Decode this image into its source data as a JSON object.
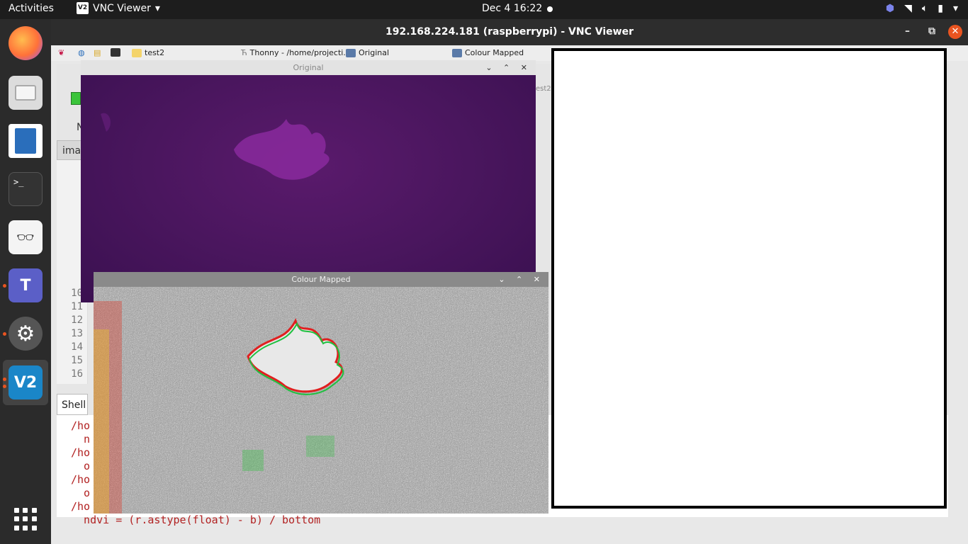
{
  "topbar": {
    "activities": "Activities",
    "app_name": "VNC Viewer",
    "clock": "Dec 4  16:22",
    "tray_icons": [
      "teams-tray-icon",
      "wifi-icon",
      "volume-icon",
      "battery-icon",
      "chevron-down-icon"
    ]
  },
  "dock": {
    "apps": [
      "firefox-icon",
      "files-icon",
      "libreoffice-impress-icon",
      "terminal-icon",
      "document-viewer-icon",
      "teams-icon",
      "settings-icon",
      "vnc-viewer-icon"
    ],
    "grid_label": "show-applications-icon"
  },
  "vnc": {
    "title": "192.168.224.181 (raspberrypi) - VNC Viewer",
    "minimize": "–",
    "maximize": "⧉",
    "close": "✕"
  },
  "remote_taskbar": {
    "items": [
      {
        "label": "test2"
      },
      {
        "label": "Thonny  -  /home/projecti..."
      },
      {
        "label": "Original"
      },
      {
        "label": "Colour Mapped"
      }
    ]
  },
  "thonny": {
    "tab_label": "ima",
    "letter_n": "N",
    "partial_tab": "est2",
    "line_numbers": [
      "10",
      "11",
      "12",
      "13",
      "14",
      "15",
      "16"
    ],
    "shell_tab": "Shell",
    "shell_lines": [
      "/ho",
      "  n",
      "/ho",
      "  o",
      "/ho",
      "  o",
      "/ho",
      "  ndvi = (r.astype(float) - b) / bottom"
    ]
  },
  "windows": {
    "original": {
      "title": "Original",
      "buttons": "⌄ ⌃ ✕"
    },
    "colour_mapped": {
      "title": "Colour Mapped",
      "buttons": "⌄ ⌃ ✕"
    }
  }
}
